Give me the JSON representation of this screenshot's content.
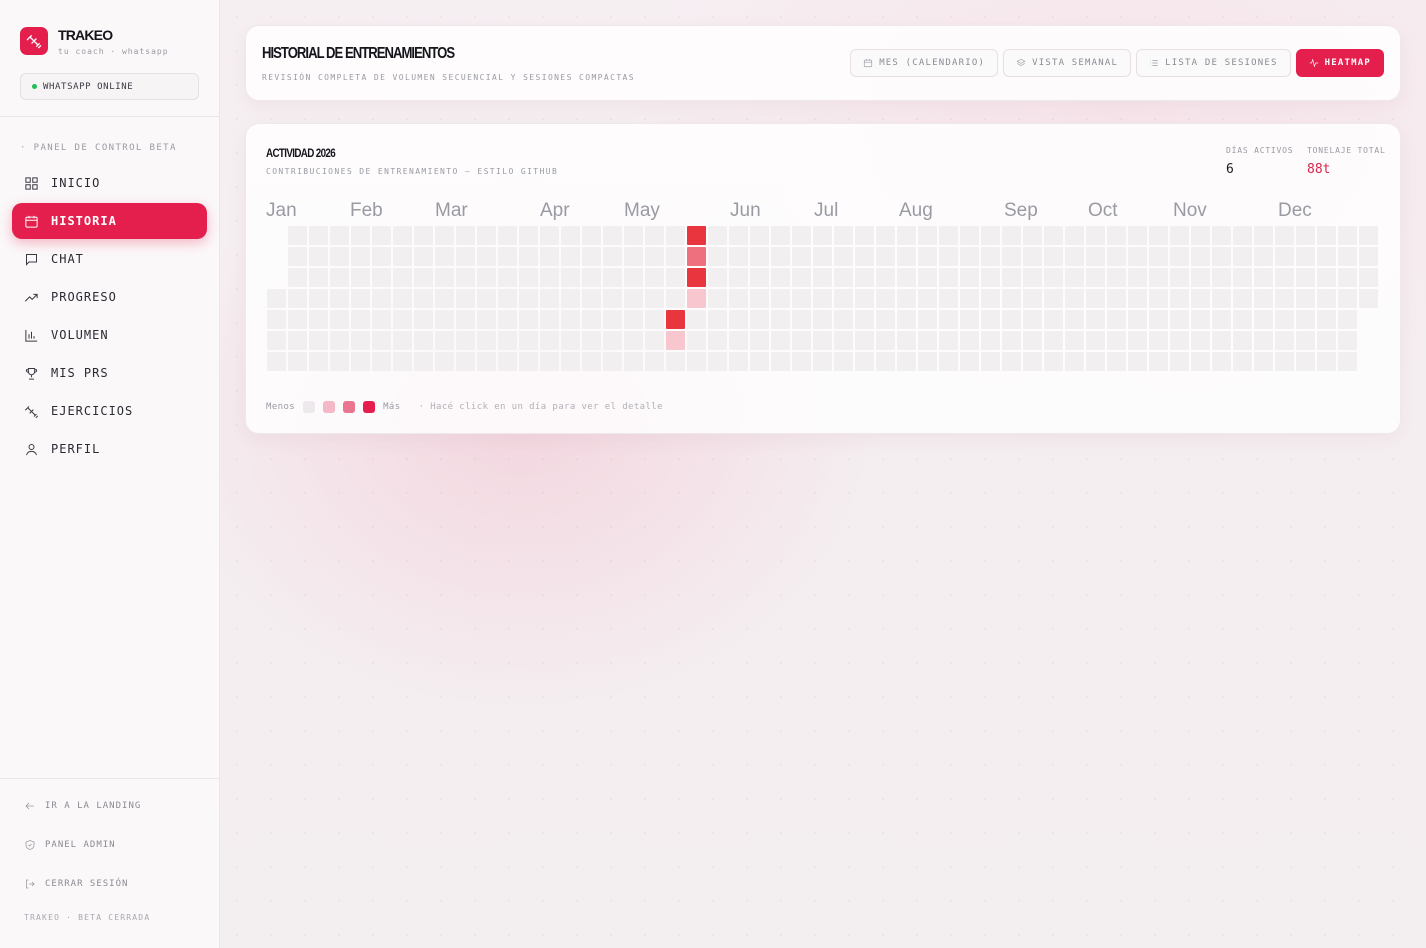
{
  "brand": {
    "name": "TRAKEO",
    "tagline": "tu coach · whatsapp"
  },
  "whatsapp_status": "WHATSAPP ONLINE",
  "sidebar": {
    "section_label": "· PANEL DE CONTROL BETA",
    "items": [
      {
        "label": "INICIO",
        "icon": "grid-icon"
      },
      {
        "label": "HISTORIA",
        "icon": "calendar-icon",
        "active": true
      },
      {
        "label": "CHAT",
        "icon": "chat-icon"
      },
      {
        "label": "PROGRESO",
        "icon": "trend-icon"
      },
      {
        "label": "VOLUMEN",
        "icon": "bar-chart-icon"
      },
      {
        "label": "MIS PRS",
        "icon": "trophy-icon"
      },
      {
        "label": "EJERCICIOS",
        "icon": "dumbbell-icon"
      },
      {
        "label": "PERFIL",
        "icon": "user-icon"
      }
    ],
    "footer_links": [
      {
        "label": "IR A LA LANDING",
        "icon": "arrow-left-icon"
      },
      {
        "label": "PANEL ADMIN",
        "icon": "shield-icon"
      },
      {
        "label": "CERRAR SESIÓN",
        "icon": "logout-icon"
      }
    ],
    "footer_note": "TRAKEO · BETA CERRADA"
  },
  "header": {
    "title": "HISTORIAL DE ENTRENAMIENTOS",
    "subtitle": "REVISIÓN COMPLETA DE VOLUMEN SECUENCIAL Y SESIONES COMPACTAS",
    "views": [
      {
        "label": "MES (CALENDARIO)",
        "icon": "calendar-icon"
      },
      {
        "label": "VISTA SEMANAL",
        "icon": "layers-icon"
      },
      {
        "label": "LISTA DE SESIONES",
        "icon": "list-icon"
      },
      {
        "label": "HEATMAP",
        "icon": "activity-icon",
        "active": true
      }
    ]
  },
  "activity": {
    "title": "ACTIVIDAD 2026",
    "subtitle": "CONTRIBUCIONES DE ENTRENAMIENTO — ESTILO GITHUB",
    "stats": [
      {
        "label": "DÍAS ACTIVOS",
        "value": "6"
      },
      {
        "label": "TONELAJE TOTAL",
        "value": "88t"
      }
    ],
    "months": [
      "Jan",
      "Feb",
      "Mar",
      "Apr",
      "May",
      "Jun",
      "Jul",
      "Aug",
      "Sep",
      "Oct",
      "Nov",
      "Dec"
    ],
    "legend": {
      "less": "Menos",
      "more": "Más",
      "hint": "· Hacé click en un día para ver el detalle"
    },
    "levels": [
      "#f1eff0",
      "#f7c6cf",
      "#ee6f7d",
      "#e8353e"
    ],
    "active_cells": [
      {
        "week": 20,
        "day": 0,
        "level": 3
      },
      {
        "week": 20,
        "day": 1,
        "level": 2
      },
      {
        "week": 20,
        "day": 2,
        "level": 3
      },
      {
        "week": 20,
        "day": 3,
        "level": 1
      },
      {
        "week": 19,
        "day": 4,
        "level": 3
      },
      {
        "week": 19,
        "day": 5,
        "level": 1
      }
    ]
  }
}
